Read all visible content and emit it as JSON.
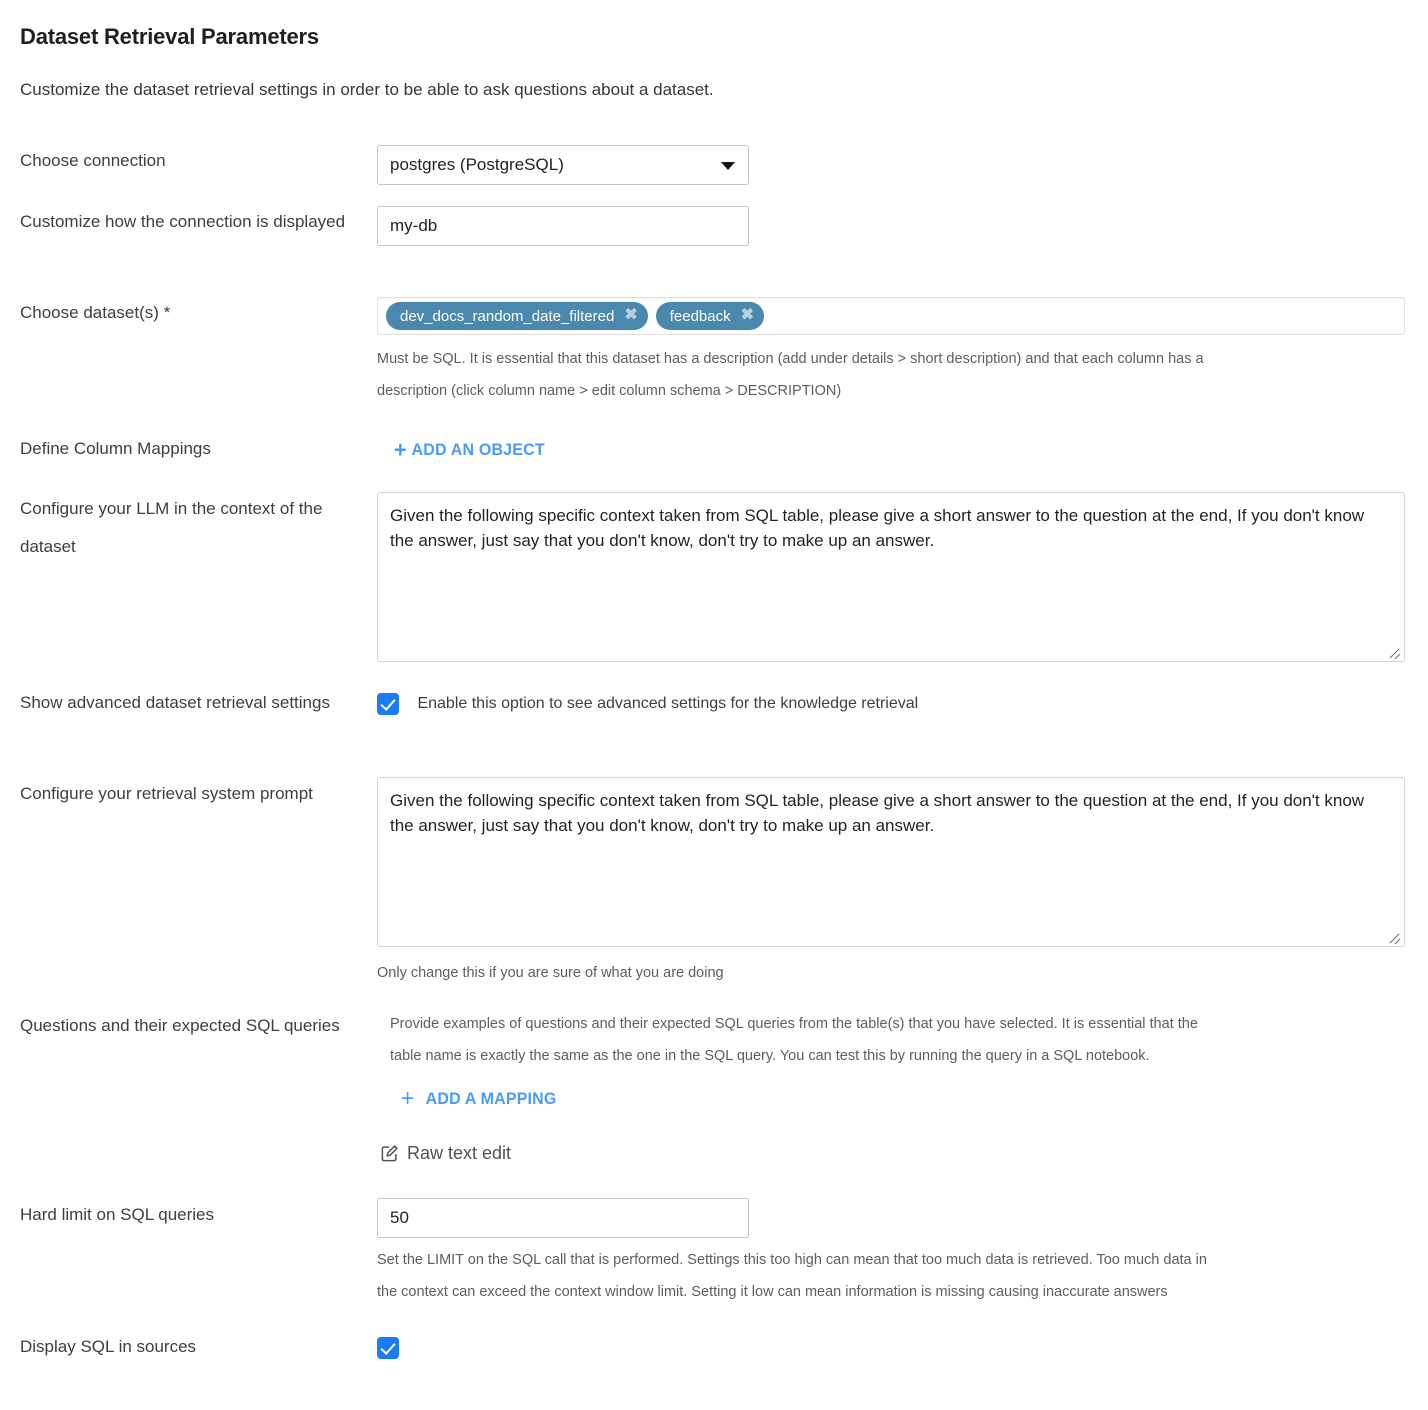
{
  "header": {
    "title": "Dataset Retrieval Parameters",
    "subtitle": "Customize the dataset retrieval settings in order to be able to ask questions about a dataset."
  },
  "colors": {
    "chip_background": "#4a88ae",
    "checkbox_accent": "#1a7bf7",
    "action_link": "#4a9bf5"
  },
  "connection": {
    "label": "Choose connection",
    "selected_option": "postgres (PostgreSQL)",
    "dropdown_icon": "chevron-down-icon"
  },
  "display_name": {
    "label": "Customize how the connection is displayed",
    "value": "my-db",
    "placeholder": ""
  },
  "datasets": {
    "label": "Choose dataset(s) *",
    "chips": [
      {
        "name": "dev_docs_random_date_filtered",
        "remove_icon": "close-icon"
      },
      {
        "name": "feedback",
        "remove_icon": "close-icon"
      }
    ],
    "help_line_1": "Must be SQL. It is essential that this dataset has a description (add under details > short description) and that each column has a",
    "help_line_2": "description (click column name > edit column schema > DESCRIPTION)"
  },
  "column_mappings": {
    "label": "Define Column Mappings",
    "add_button_label": "ADD AN OBJECT",
    "add_button_icon": "plus-icon"
  },
  "llm_context": {
    "label": "Configure your LLM in the context of the dataset",
    "value": "Given the following specific context taken from SQL table, please give a short answer to the question at the end, If you don't know the answer, just say that you don't know, don't try to make up an answer."
  },
  "advanced_toggle": {
    "label": "Show advanced dataset retrieval settings",
    "checkbox_checked": true,
    "description": "Enable this option to see advanced settings for the knowledge retrieval"
  },
  "retrieval_prompt": {
    "label": "Configure your retrieval system prompt",
    "value": "Given the following specific context taken from SQL table, please give a short answer to the question at the end, If you don't know the answer, just say that you don't know, don't try to make up an answer.",
    "help": "Only change this if you are sure of what you are doing"
  },
  "questions_sql": {
    "label": "Questions and their expected SQL queries",
    "help_line_1": "Provide examples of questions and their expected SQL queries from the table(s) that you have selected. It is essential that the",
    "help_line_2": "table name is exactly the same as the one in the SQL query. You can test this by running the query in a SQL notebook.",
    "add_mapping_label": "ADD A MAPPING",
    "add_mapping_icon": "plus-icon",
    "raw_text_edit_label": "Raw text edit",
    "raw_text_edit_icon": "edit-square-icon"
  },
  "hard_limit": {
    "label": "Hard limit on SQL queries",
    "value": "50",
    "help_line_1": "Set the LIMIT on the SQL call that is performed. Settings this too high can mean that too much data is retrieved. Too much data in",
    "help_line_2": "the context can exceed the context window limit. Setting it low can mean information is missing causing inaccurate answers"
  },
  "display_sql": {
    "label": "Display SQL in sources",
    "checkbox_checked": true
  }
}
